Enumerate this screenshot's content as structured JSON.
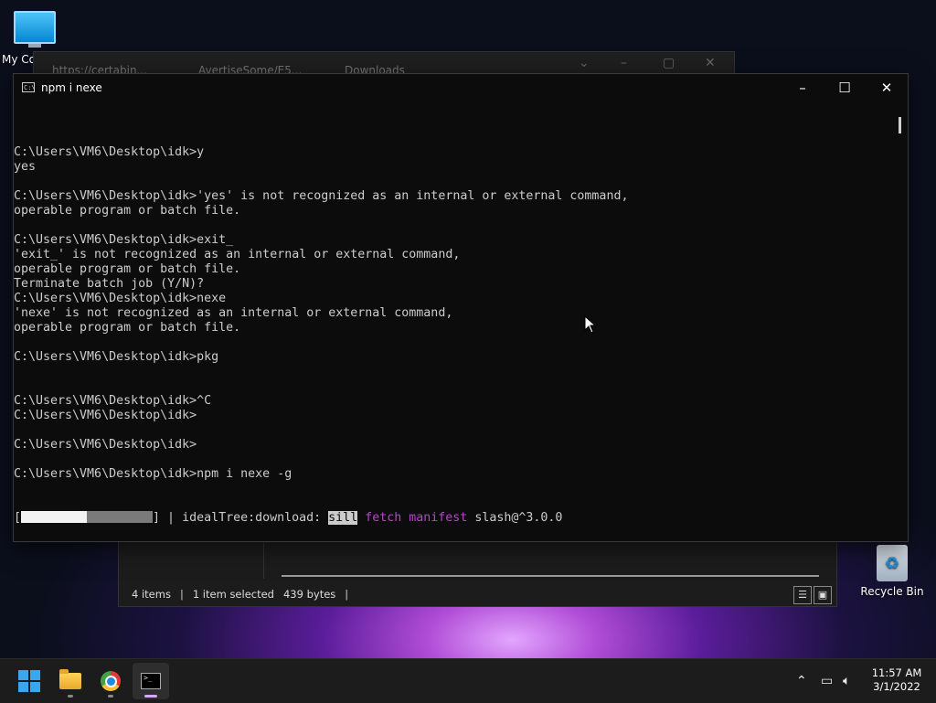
{
  "desktop": {
    "this_pc_label": "My Co",
    "recycle_bin_label": "Recycle Bin"
  },
  "browser_bg": {
    "tabs": [
      "https://certabin...",
      "AvertiseSome/E5...",
      "Downloads"
    ]
  },
  "explorer_bg": {
    "status_items": "4 items",
    "status_selected": "1 item selected",
    "status_size": "439 bytes"
  },
  "terminal": {
    "title": "npm i nexe",
    "icon_text": "C:\\",
    "lines": [
      "C:\\Users\\VM6\\Desktop\\idk>y",
      "yes",
      "",
      "C:\\Users\\VM6\\Desktop\\idk>'yes' is not recognized as an internal or external command,",
      "operable program or batch file.",
      "",
      "C:\\Users\\VM6\\Desktop\\idk>exit_",
      "'exit_' is not recognized as an internal or external command,",
      "operable program or batch file.",
      "Terminate batch job (Y/N)?",
      "C:\\Users\\VM6\\Desktop\\idk>nexe",
      "'nexe' is not recognized as an internal or external command,",
      "operable program or batch file.",
      "",
      "C:\\Users\\VM6\\Desktop\\idk>pkg",
      "",
      "",
      "C:\\Users\\VM6\\Desktop\\idk>^C",
      "C:\\Users\\VM6\\Desktop\\idk>",
      "",
      "C:\\Users\\VM6\\Desktop\\idk>",
      "",
      "C:\\Users\\VM6\\Desktop\\idk>npm i nexe -g"
    ],
    "progress": {
      "open_bracket": "[",
      "close_bracket": "]",
      "fraction_done": 0.5,
      "spinner": " | ",
      "stage": "idealTree:download: ",
      "level": "sill",
      "word1": "fetch",
      "word2": "manifest",
      "pkg": "slash@^3.0.0"
    }
  },
  "taskbar": {
    "apps": [
      "start",
      "file-explorer",
      "chrome",
      "command-prompt"
    ],
    "time": "11:57 AM",
    "date": "3/1/2022"
  },
  "colors": {
    "terminal_bg": "#0c0c0c",
    "terminal_text": "#cccccc",
    "npm_magenta": "#b148c6",
    "taskbar_bg": "#1c1c1c"
  }
}
